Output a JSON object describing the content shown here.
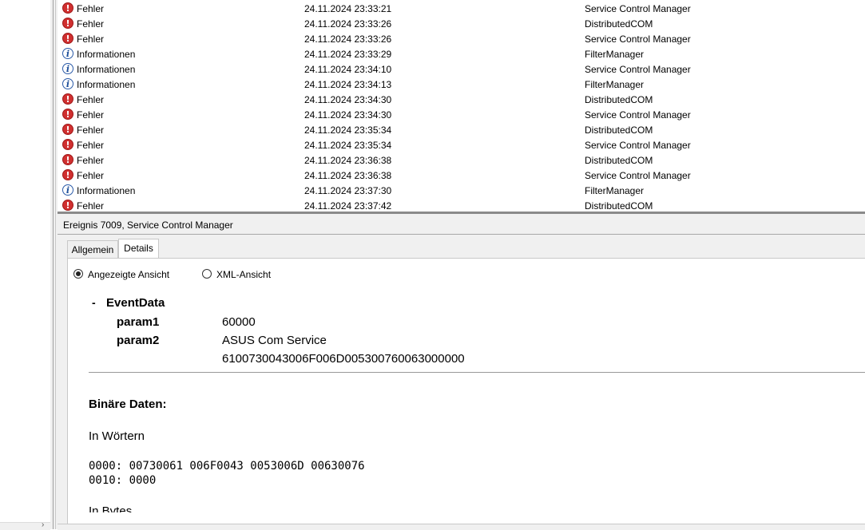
{
  "events": [
    {
      "level": "Fehler",
      "type": "error",
      "datetime": "24.11.2024 23:33:21",
      "source": "Service Control Manager"
    },
    {
      "level": "Fehler",
      "type": "error",
      "datetime": "24.11.2024 23:33:26",
      "source": "DistributedCOM"
    },
    {
      "level": "Fehler",
      "type": "error",
      "datetime": "24.11.2024 23:33:26",
      "source": "Service Control Manager"
    },
    {
      "level": "Informationen",
      "type": "info",
      "datetime": "24.11.2024 23:33:29",
      "source": "FilterManager"
    },
    {
      "level": "Informationen",
      "type": "info",
      "datetime": "24.11.2024 23:34:10",
      "source": "Service Control Manager"
    },
    {
      "level": "Informationen",
      "type": "info",
      "datetime": "24.11.2024 23:34:13",
      "source": "FilterManager"
    },
    {
      "level": "Fehler",
      "type": "error",
      "datetime": "24.11.2024 23:34:30",
      "source": "DistributedCOM"
    },
    {
      "level": "Fehler",
      "type": "error",
      "datetime": "24.11.2024 23:34:30",
      "source": "Service Control Manager"
    },
    {
      "level": "Fehler",
      "type": "error",
      "datetime": "24.11.2024 23:35:34",
      "source": "DistributedCOM"
    },
    {
      "level": "Fehler",
      "type": "error",
      "datetime": "24.11.2024 23:35:34",
      "source": "Service Control Manager"
    },
    {
      "level": "Fehler",
      "type": "error",
      "datetime": "24.11.2024 23:36:38",
      "source": "DistributedCOM"
    },
    {
      "level": "Fehler",
      "type": "error",
      "datetime": "24.11.2024 23:36:38",
      "source": "Service Control Manager"
    },
    {
      "level": "Informationen",
      "type": "info",
      "datetime": "24.11.2024 23:37:30",
      "source": "FilterManager"
    },
    {
      "level": "Fehler",
      "type": "error",
      "datetime": "24.11.2024 23:37:42",
      "source": "DistributedCOM"
    }
  ],
  "icons": {
    "error": "!",
    "info": "i"
  },
  "detail": {
    "title": "Ereignis 7009, Service Control Manager",
    "tabs": {
      "general": "Allgemein",
      "details": "Details"
    },
    "view_options": {
      "friendly": "Angezeigte Ansicht",
      "xml": "XML-Ansicht",
      "selected": "friendly"
    },
    "event_data": {
      "toggle": "-",
      "title": "EventData",
      "param1_name": "param1",
      "param1_value": "60000",
      "param2_name": "param2",
      "param2_value": "ASUS Com Service",
      "param2_extra": "6100730043006F006D005300760063000000"
    },
    "binary": {
      "heading": "Binäre Daten:",
      "words_heading": "In Wörtern",
      "lines": [
        "0000: 00730061 006F0043 0053006D 00630076",
        "0010: 0000"
      ],
      "bytes_heading": "In Bytes"
    }
  },
  "nav": {
    "chevron": "›"
  },
  "colors": {
    "error_icon": "#d03030",
    "info_icon": "#2a5aa8",
    "panel_bg": "#f0f0f0"
  }
}
